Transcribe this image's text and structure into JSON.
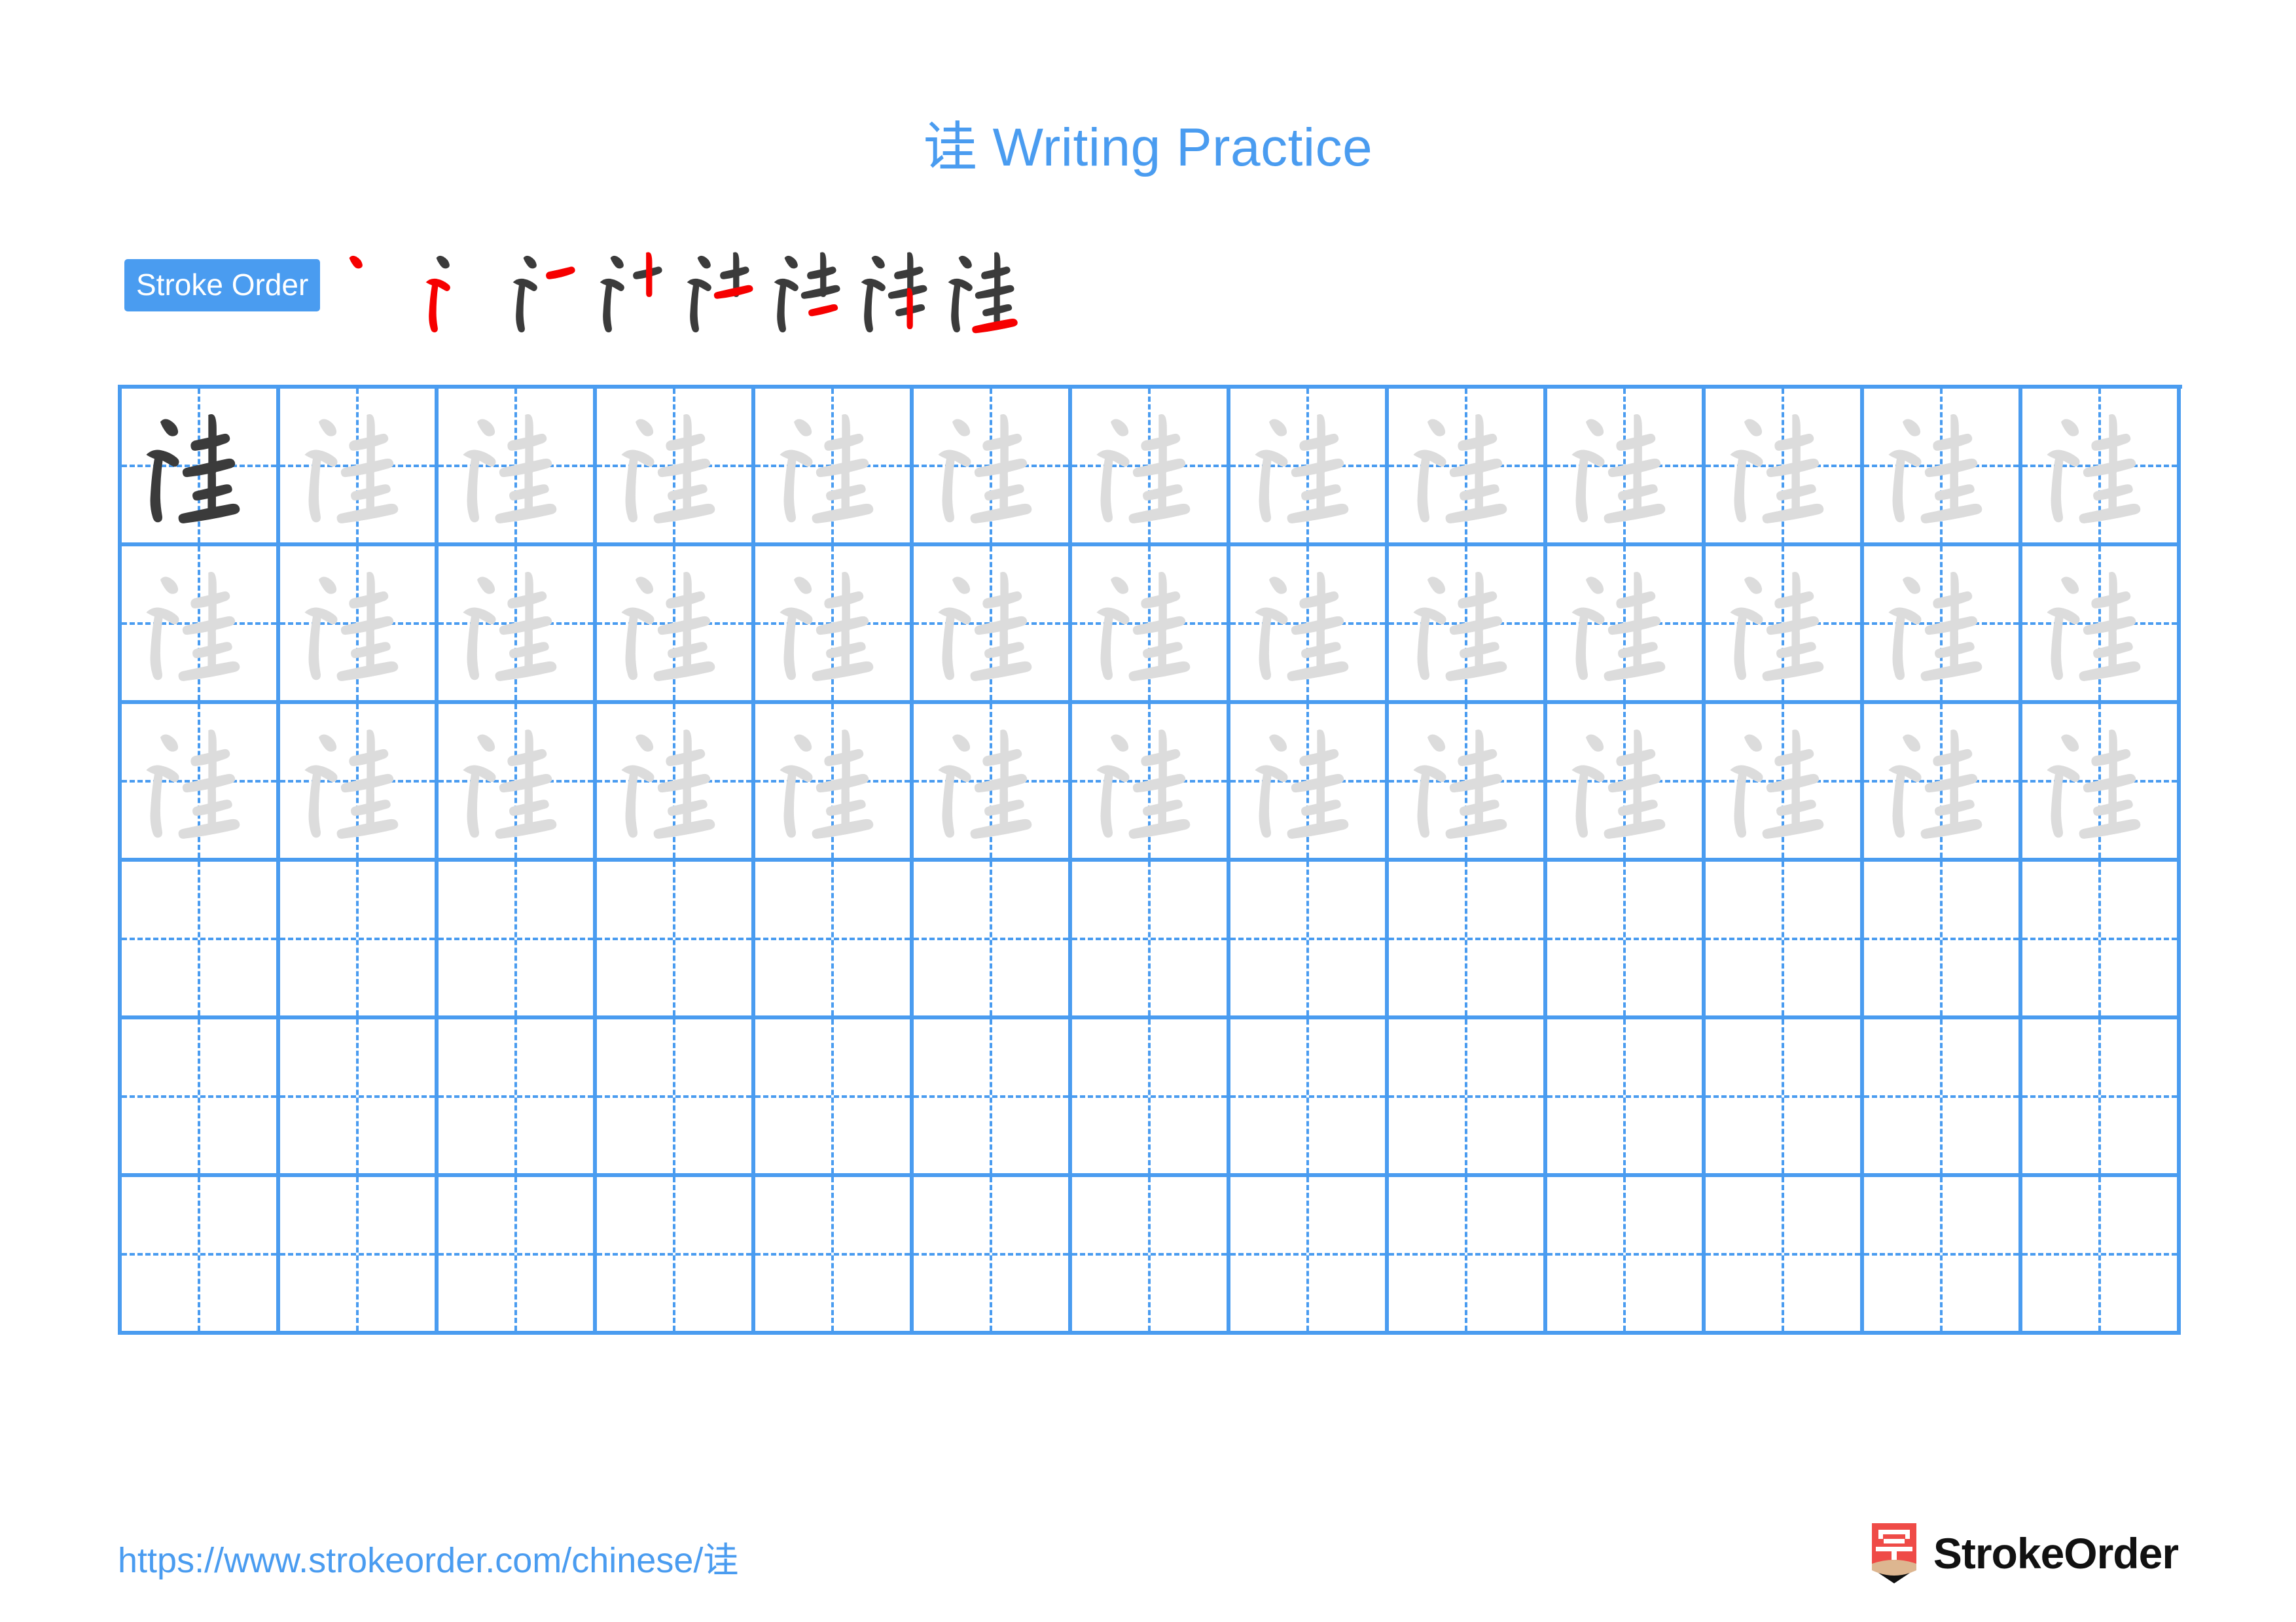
{
  "character": "诖",
  "title": "诖 Writing Practice",
  "colors": {
    "accent_blue": "#4a9cf0",
    "grid_line": "#4a9cf0",
    "guide_dash": "#4a9cf0",
    "glyph_dark": "#3b3b3b",
    "glyph_trace": "#dcdcdc",
    "stroke_new": "#f60000",
    "stroke_done": "#3b3b3b",
    "logo_red": "#ef4b47",
    "logo_wood": "#ddb690",
    "brand_text": "#111111",
    "page_background": "#ffffff"
  },
  "stroke_order": {
    "badge_label": "Stroke Order",
    "total_strokes": 8,
    "steps": [
      {
        "index": 1,
        "new_stroke": "dot",
        "strokes_shown": 1
      },
      {
        "index": 2,
        "new_stroke": "horizontal-fold-hook",
        "strokes_shown": 2
      },
      {
        "index": 3,
        "new_stroke": "horizontal",
        "strokes_shown": 3
      },
      {
        "index": 4,
        "new_stroke": "vertical",
        "strokes_shown": 4
      },
      {
        "index": 5,
        "new_stroke": "horizontal",
        "strokes_shown": 5
      },
      {
        "index": 6,
        "new_stroke": "horizontal",
        "strokes_shown": 6
      },
      {
        "index": 7,
        "new_stroke": "vertical",
        "strokes_shown": 7
      },
      {
        "index": 8,
        "new_stroke": "horizontal-base",
        "strokes_shown": 8
      }
    ]
  },
  "grid": {
    "columns": 13,
    "rows": 6,
    "rows_detail": [
      {
        "row": 1,
        "fill": "traced",
        "first_cell": "dark"
      },
      {
        "row": 2,
        "fill": "traced",
        "first_cell": "traced"
      },
      {
        "row": 3,
        "fill": "traced",
        "first_cell": "traced"
      },
      {
        "row": 4,
        "fill": "blank",
        "first_cell": "blank"
      },
      {
        "row": 5,
        "fill": "blank",
        "first_cell": "blank"
      },
      {
        "row": 6,
        "fill": "blank",
        "first_cell": "blank"
      }
    ]
  },
  "footer": {
    "url": "https://www.strokeorder.com/chinese/诖",
    "brand_name": "StrokeOrder",
    "logo_character": "字"
  }
}
